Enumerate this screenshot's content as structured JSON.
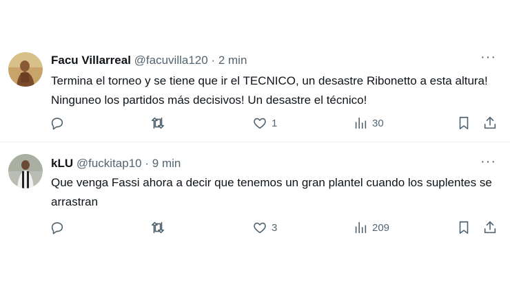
{
  "tweets": [
    {
      "name": "Facu Villarreal",
      "handle": "@facuvilla120",
      "dot": "·",
      "time": "2 min",
      "text": "Termina el torneo y se tiene que ir el TECNICO, un desastre Ribonetto a esta altura! Ninguneo los partidos más decisivos! Un desastre el técnico!",
      "likes": "1",
      "views": "30",
      "more": "···"
    },
    {
      "name": "kLU",
      "handle": "@fuckitap10",
      "dot": "·",
      "time": "9 min",
      "text": "Que venga Fassi ahora a decir que tenemos un gran plantel cuando los suplentes se arrastran",
      "likes": "3",
      "views": "209",
      "more": "···"
    }
  ],
  "icons": [
    "reply-icon",
    "retweet-icon",
    "like-icon",
    "views-icon",
    "bookmark-icon",
    "share-icon",
    "more-icon"
  ],
  "colors": {
    "text": "#0f1419",
    "secondary": "#536471",
    "divider": "#eff3f4"
  }
}
